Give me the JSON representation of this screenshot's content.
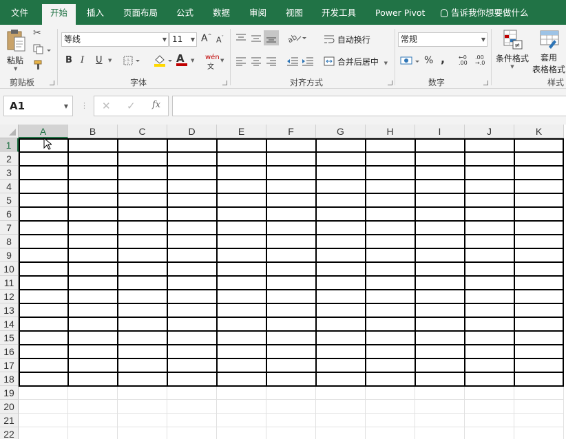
{
  "ribbon_tabs": [
    {
      "label": "文件"
    },
    {
      "label": "开始",
      "active": true
    },
    {
      "label": "插入"
    },
    {
      "label": "页面布局"
    },
    {
      "label": "公式"
    },
    {
      "label": "数据"
    },
    {
      "label": "审阅"
    },
    {
      "label": "视图"
    },
    {
      "label": "开发工具"
    },
    {
      "label": "Power Pivot"
    }
  ],
  "tell_me": "告诉我你想要做什么",
  "clipboard": {
    "paste_label": "粘贴",
    "group_label": "剪贴板"
  },
  "font": {
    "font_name": "等线",
    "font_size": "11",
    "bold": "B",
    "italic": "I",
    "underline": "U",
    "font_color_glyph": "A",
    "phonetic": "wén",
    "group_label": "字体"
  },
  "alignment": {
    "wrap_text": "自动换行",
    "merge_center": "合并后居中",
    "group_label": "对齐方式"
  },
  "number": {
    "format": "常规",
    "percent": "%",
    "comma": ",",
    "group_label": "数字"
  },
  "styles": {
    "conditional_format": "条件格式",
    "format_table_1": "套用",
    "format_table_2": "表格格式",
    "group_label": "样式"
  },
  "formula_bar": {
    "name_box": "A1",
    "fx": "fx",
    "cancel": "✕",
    "enter": "✓",
    "value": ""
  },
  "sheet": {
    "columns": [
      "A",
      "B",
      "C",
      "D",
      "E",
      "F",
      "G",
      "H",
      "I",
      "J",
      "K"
    ],
    "rows": [
      "1",
      "2",
      "3",
      "4",
      "5",
      "6",
      "7",
      "8",
      "9",
      "10",
      "11",
      "12",
      "13",
      "14",
      "15",
      "16",
      "17",
      "18",
      "19",
      "20",
      "21",
      "22"
    ],
    "selected_cell": "A1",
    "bordered_range": "A1:K18"
  },
  "colors": {
    "accent": "#217346",
    "ribbon_bg": "#f3f3f3",
    "header_bg": "#efefef"
  }
}
